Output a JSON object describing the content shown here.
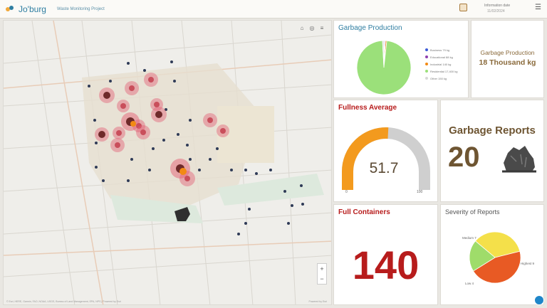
{
  "header": {
    "title": "Jo'burg",
    "subtitle": "Waste Monitoring Project",
    "info_title": "Information date",
    "info_sub": "11/02/2024",
    "menu_icon": "hamburger-menu-icon"
  },
  "map": {
    "tools": [
      "home-icon",
      "basemap-icon",
      "layer-list-icon"
    ],
    "zoom_in": "+",
    "zoom_out": "−",
    "attribution": "© Esri, HERE, Garmin, FAO, NOAA, USGS, Bureau of Land Management, EPA, NPS | Powered by Esri",
    "credit": "Powered by Esri"
  },
  "garbage_production_chart": {
    "title": "Garbage Production",
    "legend": [
      "Business 79 kg",
      "Educational 88 kg",
      "Industrial 140 kg",
      "Residential 17,400 kg",
      "Other 150 kg"
    ],
    "colors": [
      "#3d5bd6",
      "#8e3fb0",
      "#f28a14",
      "#9be07a",
      "#d7d7d7"
    ]
  },
  "garbage_production_total": {
    "label": "Garbage Production",
    "value": "18 Thousand kg"
  },
  "fullness_average": {
    "title": "Fullness Average",
    "value": "51.7",
    "min": "0",
    "max": "100",
    "fill": 0.517,
    "color": "#f39a1e"
  },
  "garbage_reports": {
    "title": "Garbage Reports",
    "value": "20",
    "icon": "garbage-bag-icon"
  },
  "full_containers": {
    "title": "Full Containers",
    "value": "140",
    "color": "#b71c1c"
  },
  "severity": {
    "title": "Severity of Reports",
    "labels": [
      "Medium 7",
      "Highest 9",
      "Low 4"
    ],
    "colors": [
      "#f4e04a",
      "#e85a24",
      "#9fdc6a"
    ]
  },
  "chart_data": [
    {
      "type": "pie",
      "title": "Garbage Production",
      "categories": [
        "Business",
        "Educational",
        "Industrial",
        "Residential",
        "Other"
      ],
      "values": [
        79,
        88,
        140,
        17400,
        150
      ],
      "unit": "kg"
    },
    {
      "type": "pie",
      "title": "Severity of Reports",
      "categories": [
        "Medium",
        "Highest",
        "Low"
      ],
      "values": [
        7,
        9,
        4
      ]
    }
  ]
}
